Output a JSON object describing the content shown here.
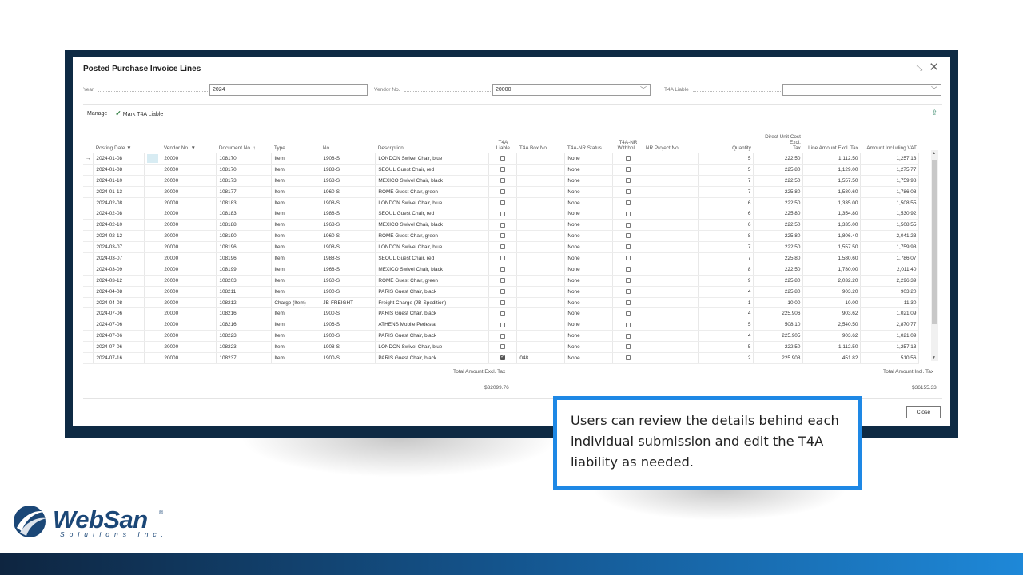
{
  "window": {
    "title": "Posted Purchase Invoice Lines"
  },
  "filters": {
    "year_label": "Year",
    "year_value": "2024",
    "vendor_label": "Vendor No.",
    "vendor_value": "20000",
    "t4a_label": "T4A Liable",
    "t4a_value": ""
  },
  "actions": {
    "manage": "Manage",
    "mark": "Mark T4A Liable"
  },
  "columns": {
    "posting_date": "Posting Date ▼",
    "vendor_no": "Vendor No. ▼",
    "document_no": "Document No. ↑",
    "type": "Type",
    "no": "No.",
    "description": "Description",
    "t4a_liable_1": "T4A",
    "t4a_liable_2": "Liable",
    "t4a_box": "T4A Box No.",
    "nr_status": "T4A-NR Status",
    "nr_withhold_1": "T4A-NR",
    "nr_withhold_2": "Withhol...",
    "nr_project": "NR Project No.",
    "quantity": "Quantity",
    "direct_cost_1": "Direct Unit Cost Excl.",
    "direct_cost_2": "Tax",
    "line_amount": "Line Amount Excl. Tax",
    "amount_vat": "Amount Including VAT"
  },
  "rows": [
    {
      "date": "2024-01-08",
      "vendor": "20000",
      "doc": "108170",
      "type": "Item",
      "no": "1908-S",
      "desc": "LONDON Swivel Chair, blue",
      "t4a": false,
      "box": "",
      "status": "None",
      "qty": "5",
      "cost": "222.50",
      "line": "1,112.50",
      "vat": "1,257.13"
    },
    {
      "date": "2024-01-08",
      "vendor": "20000",
      "doc": "108170",
      "type": "Item",
      "no": "1988-S",
      "desc": "SEOUL Guest Chair, red",
      "t4a": false,
      "box": "",
      "status": "None",
      "qty": "5",
      "cost": "225.80",
      "line": "1,129.00",
      "vat": "1,275.77"
    },
    {
      "date": "2024-01-10",
      "vendor": "20000",
      "doc": "108173",
      "type": "Item",
      "no": "1968-S",
      "desc": "MEXICO Swivel Chair, black",
      "t4a": false,
      "box": "",
      "status": "None",
      "qty": "7",
      "cost": "222.50",
      "line": "1,557.50",
      "vat": "1,759.98"
    },
    {
      "date": "2024-01-13",
      "vendor": "20000",
      "doc": "108177",
      "type": "Item",
      "no": "1960-S",
      "desc": "ROME Guest Chair, green",
      "t4a": false,
      "box": "",
      "status": "None",
      "qty": "7",
      "cost": "225.80",
      "line": "1,580.60",
      "vat": "1,786.08"
    },
    {
      "date": "2024-02-08",
      "vendor": "20000",
      "doc": "108183",
      "type": "Item",
      "no": "1908-S",
      "desc": "LONDON Swivel Chair, blue",
      "t4a": false,
      "box": "",
      "status": "None",
      "qty": "6",
      "cost": "222.50",
      "line": "1,335.00",
      "vat": "1,508.55"
    },
    {
      "date": "2024-02-08",
      "vendor": "20000",
      "doc": "108183",
      "type": "Item",
      "no": "1988-S",
      "desc": "SEOUL Guest Chair, red",
      "t4a": false,
      "box": "",
      "status": "None",
      "qty": "6",
      "cost": "225.80",
      "line": "1,354.80",
      "vat": "1,530.92"
    },
    {
      "date": "2024-02-10",
      "vendor": "20000",
      "doc": "108188",
      "type": "Item",
      "no": "1968-S",
      "desc": "MEXICO Swivel Chair, black",
      "t4a": false,
      "box": "",
      "status": "None",
      "qty": "6",
      "cost": "222.50",
      "line": "1,335.00",
      "vat": "1,508.55"
    },
    {
      "date": "2024-02-12",
      "vendor": "20000",
      "doc": "108190",
      "type": "Item",
      "no": "1960-S",
      "desc": "ROME Guest Chair, green",
      "t4a": false,
      "box": "",
      "status": "None",
      "qty": "8",
      "cost": "225.80",
      "line": "1,806.40",
      "vat": "2,041.23"
    },
    {
      "date": "2024-03-07",
      "vendor": "20000",
      "doc": "108196",
      "type": "Item",
      "no": "1908-S",
      "desc": "LONDON Swivel Chair, blue",
      "t4a": false,
      "box": "",
      "status": "None",
      "qty": "7",
      "cost": "222.50",
      "line": "1,557.50",
      "vat": "1,759.98"
    },
    {
      "date": "2024-03-07",
      "vendor": "20000",
      "doc": "108196",
      "type": "Item",
      "no": "1988-S",
      "desc": "SEOUL Guest Chair, red",
      "t4a": false,
      "box": "",
      "status": "None",
      "qty": "7",
      "cost": "225.80",
      "line": "1,580.60",
      "vat": "1,786.07"
    },
    {
      "date": "2024-03-09",
      "vendor": "20000",
      "doc": "108199",
      "type": "Item",
      "no": "1968-S",
      "desc": "MEXICO Swivel Chair, black",
      "t4a": false,
      "box": "",
      "status": "None",
      "qty": "8",
      "cost": "222.50",
      "line": "1,780.00",
      "vat": "2,011.40"
    },
    {
      "date": "2024-03-12",
      "vendor": "20000",
      "doc": "108203",
      "type": "Item",
      "no": "1960-S",
      "desc": "ROME Guest Chair, green",
      "t4a": false,
      "box": "",
      "status": "None",
      "qty": "9",
      "cost": "225.80",
      "line": "2,032.20",
      "vat": "2,296.39"
    },
    {
      "date": "2024-04-08",
      "vendor": "20000",
      "doc": "108211",
      "type": "Item",
      "no": "1900-S",
      "desc": "PARIS Guest Chair, black",
      "t4a": false,
      "box": "",
      "status": "None",
      "qty": "4",
      "cost": "225.80",
      "line": "903.20",
      "vat": "903.20"
    },
    {
      "date": "2024-04-08",
      "vendor": "20000",
      "doc": "108212",
      "type": "Charge (Item)",
      "no": "JB-FREIGHT",
      "desc": "Freight Charge (JB-Spedition)",
      "t4a": false,
      "box": "",
      "status": "None",
      "qty": "1",
      "cost": "10.00",
      "line": "10.00",
      "vat": "11.30"
    },
    {
      "date": "2024-07-06",
      "vendor": "20000",
      "doc": "108216",
      "type": "Item",
      "no": "1900-S",
      "desc": "PARIS Guest Chair, black",
      "t4a": false,
      "box": "",
      "status": "None",
      "qty": "4",
      "cost": "225.906",
      "line": "903.62",
      "vat": "1,021.09"
    },
    {
      "date": "2024-07-06",
      "vendor": "20000",
      "doc": "108216",
      "type": "Item",
      "no": "1906-S",
      "desc": "ATHENS Mobile Pedestal",
      "t4a": false,
      "box": "",
      "status": "None",
      "qty": "5",
      "cost": "508.10",
      "line": "2,540.50",
      "vat": "2,870.77"
    },
    {
      "date": "2024-07-06",
      "vendor": "20000",
      "doc": "108223",
      "type": "Item",
      "no": "1900-S",
      "desc": "PARIS Guest Chair, black",
      "t4a": false,
      "box": "",
      "status": "None",
      "qty": "4",
      "cost": "225.905",
      "line": "903.62",
      "vat": "1,021.09"
    },
    {
      "date": "2024-07-06",
      "vendor": "20000",
      "doc": "108223",
      "type": "Item",
      "no": "1908-S",
      "desc": "LONDON Swivel Chair, blue",
      "t4a": false,
      "box": "",
      "status": "None",
      "qty": "5",
      "cost": "222.50",
      "line": "1,112.50",
      "vat": "1,257.13"
    },
    {
      "date": "2024-07-16",
      "vendor": "20000",
      "doc": "108237",
      "type": "Item",
      "no": "1900-S",
      "desc": "PARIS Guest Chair, black",
      "t4a": true,
      "box": "048",
      "status": "None",
      "qty": "2",
      "cost": "225.908",
      "line": "451.82",
      "vat": "510.56"
    }
  ],
  "totals": {
    "excl_label": "Total Amount Excl. Tax",
    "excl_value": "$32099.76",
    "incl_label": "Total Amount Incl. Tax",
    "incl_value": "$36155.33"
  },
  "close_label": "Close",
  "callout": "Users can review the details behind each individual submission and edit the T4A liability as needed.",
  "logo": {
    "name": "WebSan",
    "sub": "Solutions Inc.",
    "reg": "®"
  },
  "colors": {
    "frame": "#0e2a44",
    "accent": "#1e88e5",
    "brand": "#1b4777"
  }
}
